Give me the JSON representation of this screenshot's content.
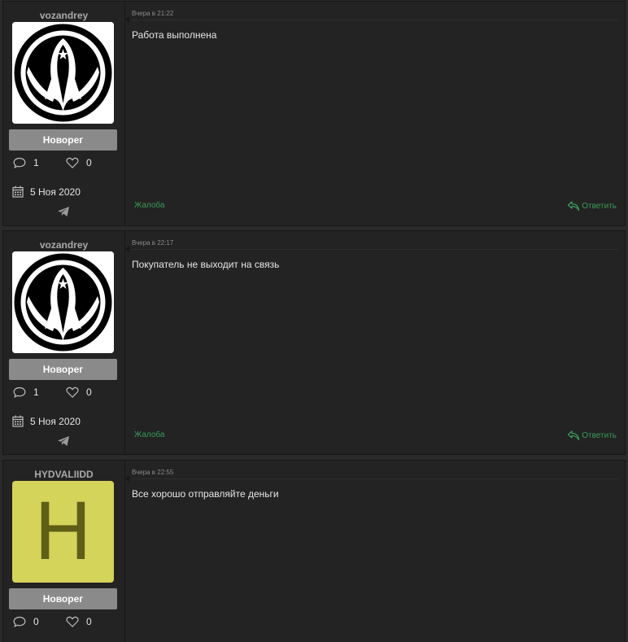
{
  "posts": [
    {
      "username": "vozandrey",
      "avatar": {
        "type": "emblem",
        "icon": "galactic-republic-emblem"
      },
      "rank": "Новорег",
      "messages": "1",
      "likes": "0",
      "reg_date": "5 Ноя 2020",
      "date": "Вчера в 21:22",
      "message": "Работа выполнена",
      "report_label": "Жалоба",
      "reply_label": "Ответить"
    },
    {
      "username": "vozandrey",
      "avatar": {
        "type": "emblem",
        "icon": "galactic-republic-emblem"
      },
      "rank": "Новорег",
      "messages": "1",
      "likes": "0",
      "reg_date": "5 Ноя 2020",
      "date": "Вчера в 22:17",
      "message": "Покупатель не выходит на связь",
      "report_label": "Жалоба",
      "reply_label": "Ответить"
    },
    {
      "username": "HYDVALIIDD",
      "avatar": {
        "type": "letter",
        "letter": "H",
        "bg_color": "#d4d35a",
        "fg_color": "#5e5e17"
      },
      "rank": "Новорег",
      "messages": "0",
      "likes": "0",
      "date": "Вчера в 22:55",
      "message": "Все хорошо отправляйте деньги"
    }
  ],
  "colors": {
    "background": "#2a2a2a",
    "panel": "#232323",
    "rank_badge": "#8a8a8a",
    "link_green": "#3a9a5a"
  },
  "icons": [
    "comment-icon",
    "heart-icon",
    "calendar-icon",
    "telegram-icon",
    "reply-arrow-icon"
  ]
}
